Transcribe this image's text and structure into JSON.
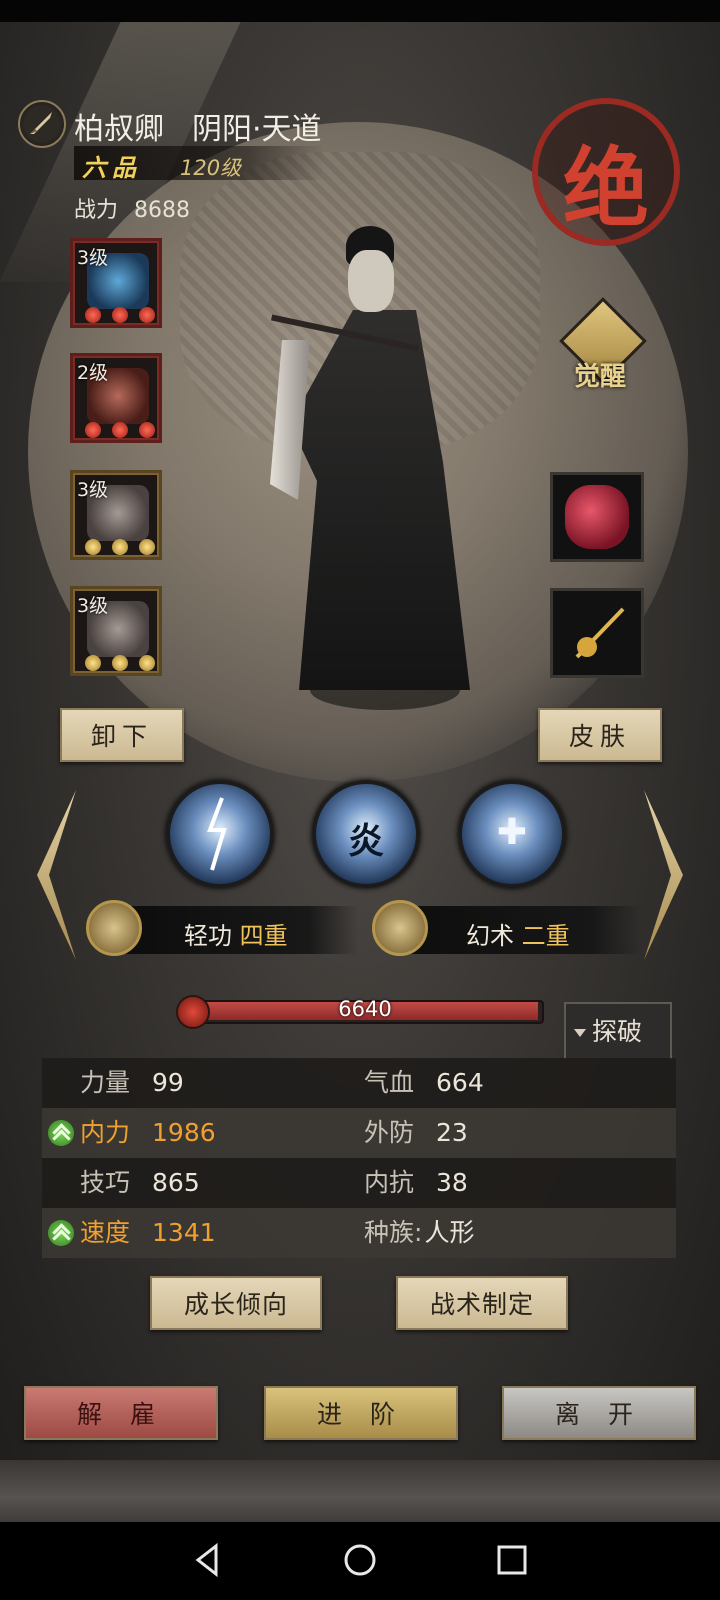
{
  "hero": {
    "name": "柏叔卿",
    "sect": "阴阳·天道",
    "grade": "六品",
    "level": "120级",
    "power_label": "战力",
    "power_value": "8688",
    "rarity_seal": "绝",
    "awaken_label": "觉醒"
  },
  "equipment_left": [
    {
      "level": "3级",
      "item": "blue-staff-icon",
      "frame": "red"
    },
    {
      "level": "2级",
      "item": "red-robe-icon",
      "frame": "red"
    },
    {
      "level": "3级",
      "item": "iron-vest-icon",
      "frame": "gold"
    },
    {
      "level": "3级",
      "item": "iron-vest-icon",
      "frame": "gold"
    }
  ],
  "equipment_right": [
    {
      "item": "red-gem-icon"
    },
    {
      "item": "golden-hairpin-icon"
    }
  ],
  "buttons": {
    "unequip": "卸下",
    "skin": "皮肤",
    "growth": "成长倾向",
    "tactics": "战术制定",
    "dismiss": "解 雇",
    "advance": "进 阶",
    "leave": "离 开"
  },
  "skills": [
    {
      "icon": "lightning-skill-icon",
      "glyph": ""
    },
    {
      "icon": "flame-skill-icon",
      "glyph": "炎"
    },
    {
      "icon": "heal-skill-icon",
      "glyph": "✚"
    }
  ],
  "arts": [
    {
      "name": "轻功",
      "rank": "四重",
      "icon": "qinggong-badge-icon"
    },
    {
      "name": "幻术",
      "rank": "二重",
      "icon": "illusion-badge-icon"
    }
  ],
  "hp": {
    "value": "6640",
    "fill_fraction": 1.0
  },
  "explore_label": "探破",
  "stats": [
    {
      "left": {
        "key": "力量",
        "value": "99",
        "highlight": false
      },
      "right": {
        "key": "气血",
        "value": "664"
      }
    },
    {
      "left": {
        "key": "内力",
        "value": "1986",
        "highlight": true
      },
      "right": {
        "key": "外防",
        "value": "23"
      }
    },
    {
      "left": {
        "key": "技巧",
        "value": "865",
        "highlight": false
      },
      "right": {
        "key": "内抗",
        "value": "38"
      }
    },
    {
      "left": {
        "key": "速度",
        "value": "1341",
        "highlight": true
      },
      "right": {
        "key": "种族:",
        "value": "人形"
      }
    }
  ],
  "colors": {
    "highlight": "#f0a02e",
    "seal_red": "#d04130",
    "grade_gold": "#f3d25a",
    "dismiss_red": "#c97a72",
    "advance_gold": "#d9c27c",
    "leave_gray": "#c8c6c2"
  },
  "nav": [
    "back-icon",
    "home-icon",
    "recents-icon"
  ]
}
